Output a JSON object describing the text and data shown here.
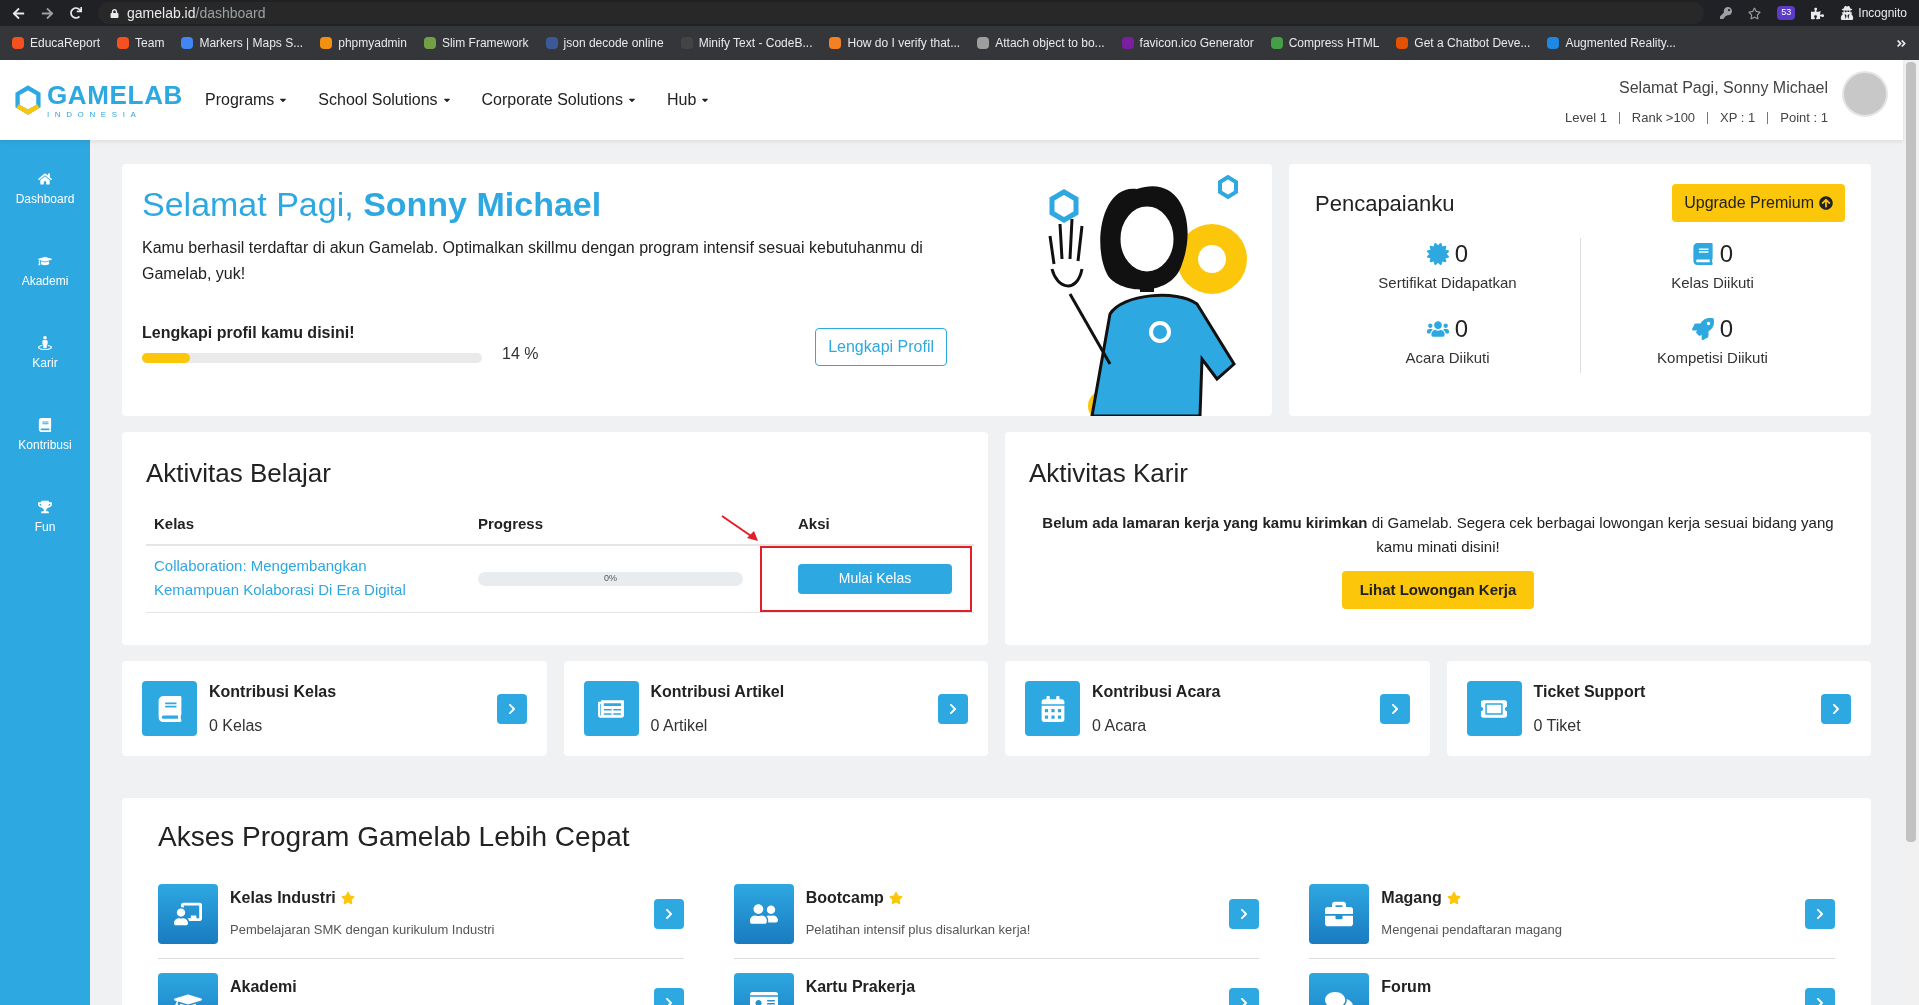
{
  "browser": {
    "url_host": "gamelab.id",
    "url_path": "/dashboard",
    "extension_badge": "53",
    "profile_label": "Incognito",
    "bookmarks": [
      {
        "label": "EducaReport",
        "color": "#f4511e"
      },
      {
        "label": "Team",
        "color": "#f4511e"
      },
      {
        "label": "Markers | Maps S...",
        "color": "#4285f4"
      },
      {
        "label": "phpmyadmin",
        "color": "#f29111"
      },
      {
        "label": "Slim Framework",
        "color": "#74a045"
      },
      {
        "label": "json decode online",
        "color": "#3b5998"
      },
      {
        "label": "Minify Text - CodeB...",
        "color": "#444444"
      },
      {
        "label": "How do I verify that...",
        "color": "#f48024"
      },
      {
        "label": "Attach object to bo...",
        "color": "#9e9e9e"
      },
      {
        "label": "favicon.ico Generator",
        "color": "#7b1fa2"
      },
      {
        "label": "Compress HTML",
        "color": "#43a047"
      },
      {
        "label": "Get a Chatbot Deve...",
        "color": "#e65100"
      },
      {
        "label": "Augmented Reality...",
        "color": "#1e88e5"
      }
    ]
  },
  "header": {
    "logo": "GAMELAB",
    "logo_sub": "INDONESIA",
    "nav": [
      "Programs",
      "School Solutions",
      "Corporate Solutions",
      "Hub"
    ],
    "greeting": "Selamat Pagi, Sonny Michael",
    "stats": [
      "Level 1",
      "Rank >100",
      "XP : 1",
      "Point : 1"
    ]
  },
  "sidebar": {
    "items": [
      {
        "kind": "home",
        "label": "Dashboard"
      },
      {
        "kind": "academy",
        "label": "Akademi"
      },
      {
        "kind": "career",
        "label": "Karir"
      },
      {
        "kind": "contribution",
        "label": "Kontribusi"
      },
      {
        "kind": "fun",
        "label": "Fun"
      }
    ]
  },
  "hero": {
    "greeting": "Selamat Pagi,",
    "name": "Sonny Michael",
    "message": "Kamu berhasil terdaftar di akun Gamelab. Optimalkan skillmu dengan program intensif sesuai kebutuhanmu di Gamelab, yuk!",
    "profile_prompt": "Lengkapi profil kamu disini!",
    "level": 0.14,
    "percent": "14 %",
    "button": "Lengkapi Profil"
  },
  "achievements": {
    "title": "Pencapaianku",
    "button": "Upgrade Premium",
    "stats": [
      {
        "kind": "certificate",
        "value": "0",
        "label": "Sertifikat Didapatkan"
      },
      {
        "kind": "class",
        "value": "0",
        "label": "Kelas Diikuti"
      },
      {
        "kind": "event",
        "value": "0",
        "label": "Acara Diikuti"
      },
      {
        "kind": "competition",
        "value": "0",
        "label": "Kompetisi Diikuti"
      }
    ]
  },
  "learning": {
    "title": "Aktivitas Belajar",
    "columns": [
      "Kelas",
      "Progress",
      "Aksi"
    ],
    "rows": [
      {
        "course": "Collaboration: Mengembangkan Kemampuan Kolaborasi Di Era Digital",
        "level": 0,
        "progress_label": "0%",
        "action": "Mulai Kelas",
        "highlighted": true
      }
    ]
  },
  "career": {
    "title": "Aktivitas Karir",
    "message": "**Belum ada lamaran kerja yang kamu kirimkan** di Gamelab. Segera cek berbagai lowongan kerja sesuai bidang yang kamu minati disini!",
    "button": "Lihat Lowongan Kerja"
  },
  "contributions": [
    {
      "kind": "class",
      "title": "Kontribusi Kelas",
      "count": "0 Kelas"
    },
    {
      "kind": "article",
      "title": "Kontribusi Artikel",
      "count": "0 Artikel"
    },
    {
      "kind": "event",
      "title": "Kontribusi Acara",
      "count": "0 Acara"
    },
    {
      "kind": "ticket",
      "title": "Ticket Support",
      "count": "0 Tiket"
    }
  ],
  "programs": {
    "title": "Akses Program Gamelab Lebih Cepat",
    "items": [
      {
        "kind": "industry",
        "title": "Kelas Industri",
        "featured": true,
        "description": "Pembelajaran SMK dengan kurikulum Industri"
      },
      {
        "kind": "bootcamp",
        "title": "Bootcamp",
        "featured": true,
        "description": "Pelatihan intensif plus disalurkan kerja!"
      },
      {
        "kind": "internship",
        "title": "Magang",
        "featured": true,
        "description": "Mengenai pendaftaran magang"
      },
      {
        "kind": "academy",
        "title": "Akademi",
        "featured": false
      },
      {
        "kind": "card",
        "title": "Kartu Prakerja",
        "featured": false
      },
      {
        "kind": "forum",
        "title": "Forum",
        "featured": false
      }
    ]
  }
}
